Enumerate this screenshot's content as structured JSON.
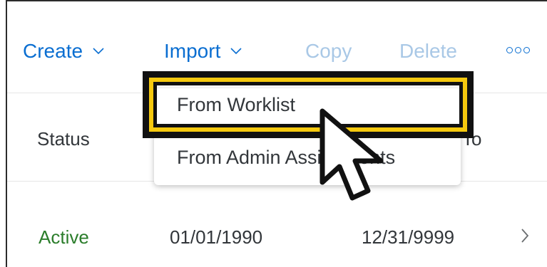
{
  "toolbar": {
    "create_label": "Create",
    "import_label": "Import",
    "copy_label": "Copy",
    "delete_label": "Delete"
  },
  "table": {
    "columns": [
      "Status",
      "To"
    ],
    "rows": [
      {
        "status": "Active",
        "start": "01/01/1990",
        "end": "12/31/9999"
      }
    ]
  },
  "import_menu": {
    "items": [
      "From Worklist",
      "From Admin Assignments"
    ],
    "highlighted_index": 0
  },
  "colors": {
    "accent": "#0a6ed1",
    "status_active": "#2b7d2b",
    "highlight": "#f6c90e"
  }
}
